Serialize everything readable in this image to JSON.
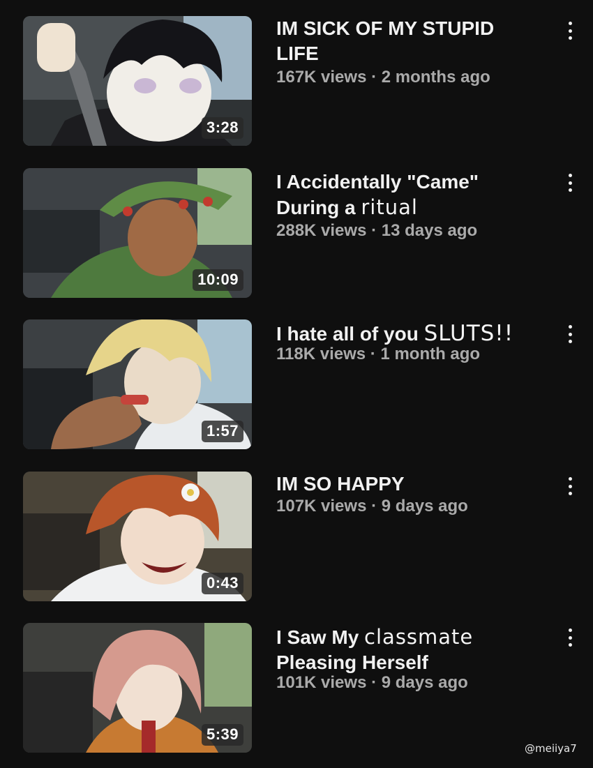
{
  "videos": [
    {
      "title": "IM SICK OF MY STUPID LIFE",
      "title_handwritten": "",
      "views": "167K views",
      "age": "2 months ago",
      "meta": "167K views · 2 months ago",
      "duration": "3:28"
    },
    {
      "title": "I Accidentally \"Came\" During a ",
      "title_handwritten": "ritual",
      "views": "288K views",
      "age": "13 days ago",
      "meta": "288K views · 13 days ago",
      "duration": "10:09"
    },
    {
      "title": "I hate all of you ",
      "title_handwritten": "SLUTS!!",
      "views": "118K views",
      "age": "1 month ago",
      "meta": "118K views · 1 month ago",
      "duration": "1:57"
    },
    {
      "title": "IM SO HAPPY",
      "title_handwritten": "",
      "views": "107K views",
      "age": "9 days ago",
      "meta": "107K views · 9 days ago",
      "duration": "0:43"
    },
    {
      "title_prefix": "I Saw My ",
      "title_handwritten": "classmate",
      "title_suffix": "Pleasing Herself",
      "views": "101K views",
      "age": "9 days ago",
      "meta": "101K views · 9 days ago",
      "duration": "5:39"
    }
  ],
  "watermark": "@meiiya7",
  "icons": {
    "more": "more-vert-icon"
  },
  "colors": {
    "background": "#0f0f0f",
    "title": "#f1f1f1",
    "meta": "#aaaaaa"
  }
}
